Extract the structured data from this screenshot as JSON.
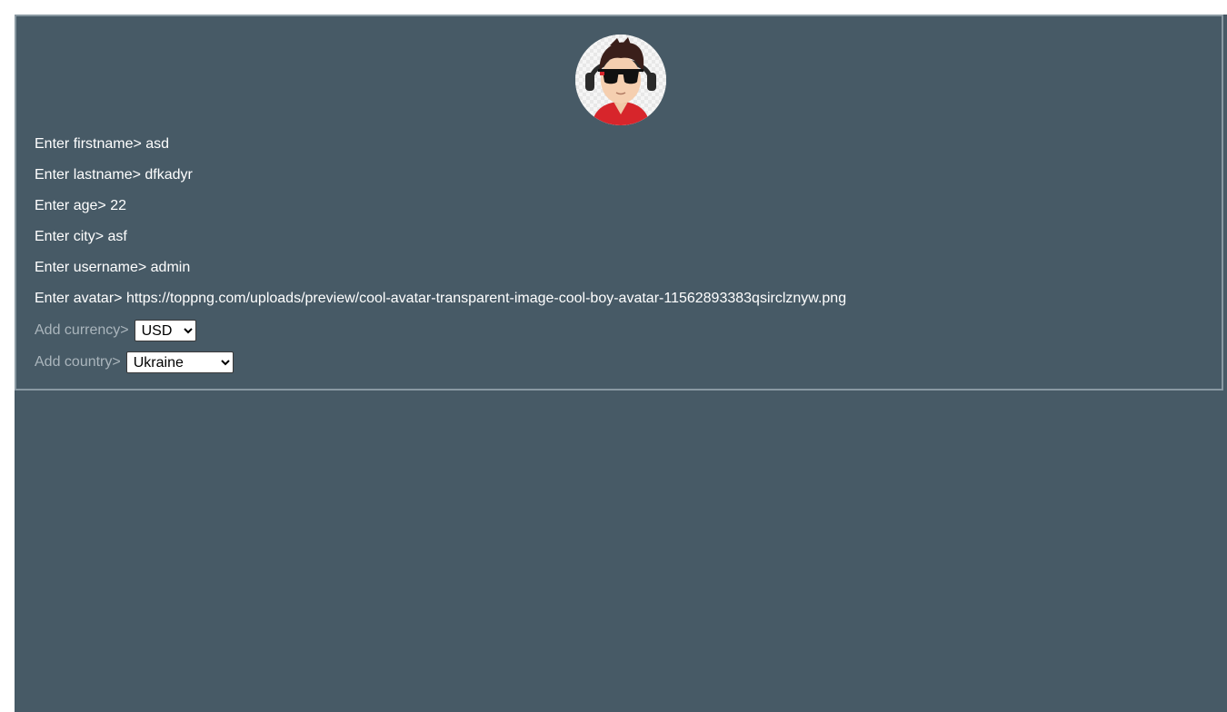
{
  "profile": {
    "avatar_alt": "cool boy avatar",
    "lines": [
      {
        "prompt": "Enter firstname>",
        "value": "asd"
      },
      {
        "prompt": "Enter lastname>",
        "value": "dfkadyr"
      },
      {
        "prompt": "Enter age>",
        "value": "22"
      },
      {
        "prompt": "Enter city>",
        "value": "asf"
      },
      {
        "prompt": "Enter username>",
        "value": "admin"
      },
      {
        "prompt": "Enter avatar>",
        "value": "https://toppng.com/uploads/preview/cool-avatar-transparent-image-cool-boy-avatar-11562893383qsirclznyw.png"
      }
    ]
  },
  "currency": {
    "label": "Add currency>",
    "selected": "USD"
  },
  "country": {
    "label": "Add country>",
    "selected": "Ukraine"
  },
  "colors": {
    "background": "#475a66",
    "border": "#8a99a2",
    "text": "#ffffff",
    "muted_text": "#aab5bc"
  }
}
